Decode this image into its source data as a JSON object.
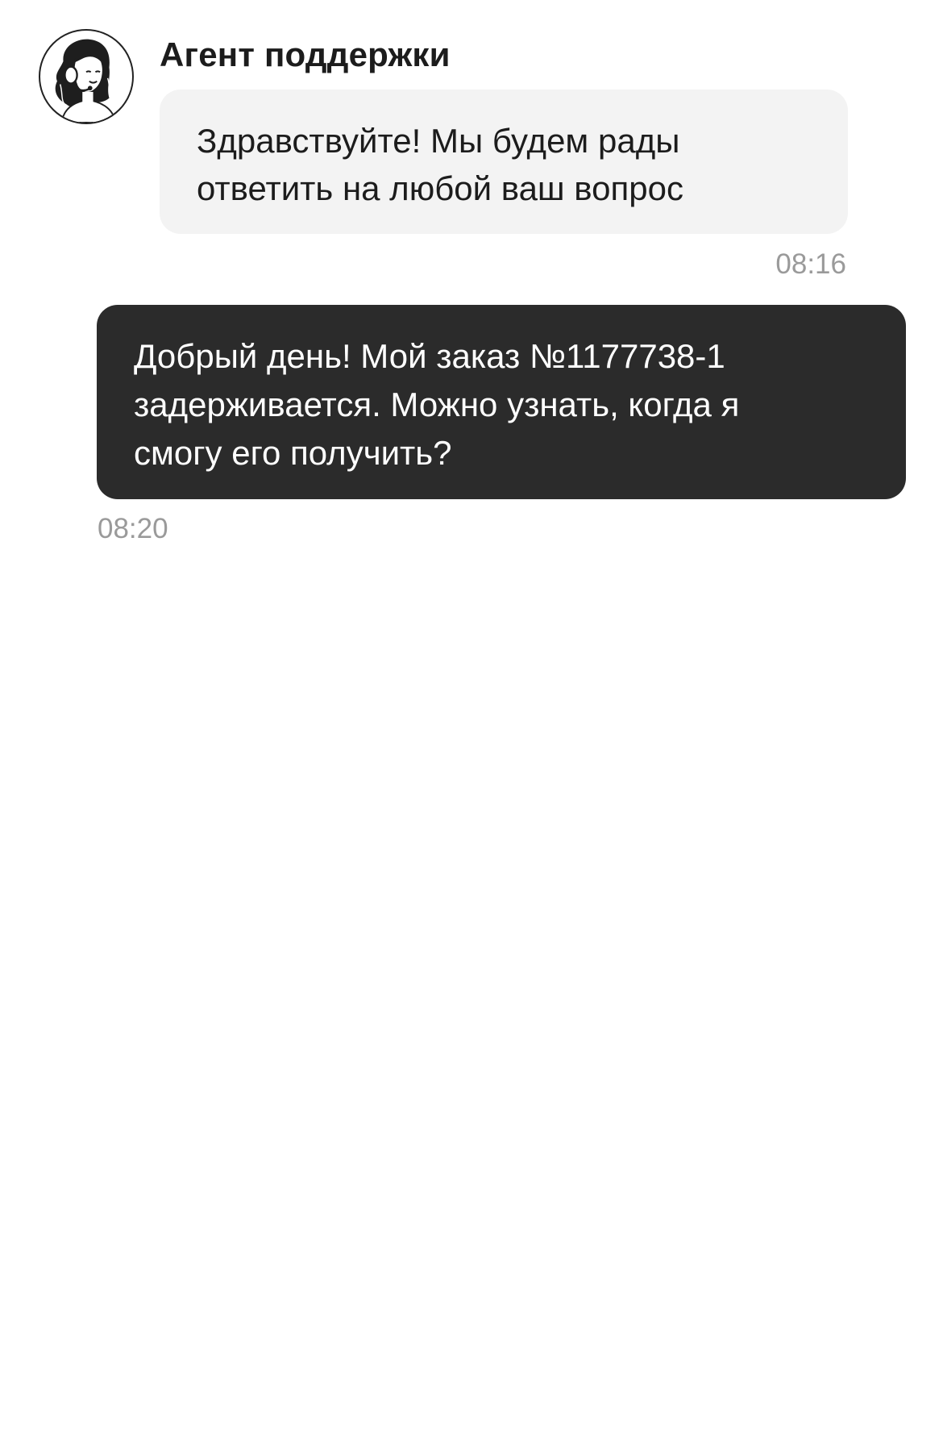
{
  "agent": {
    "name": "Агент поддержки",
    "avatar_icon": "support-agent-headset-icon"
  },
  "messages": [
    {
      "direction": "incoming",
      "text": "Здравствуйте! Мы будем рады\nответить на любой ваш вопрос",
      "time": "08:16"
    },
    {
      "direction": "outgoing",
      "text": "Добрый день! Мой заказ №1177738-1\nзадерживается. Можно узнать, когда я\nсмогу его получить?",
      "time": "08:20"
    }
  ],
  "colors": {
    "incoming_bubble": "#f3f3f3",
    "outgoing_bubble": "#2b2b2b",
    "timestamp": "#9a9a9a"
  }
}
